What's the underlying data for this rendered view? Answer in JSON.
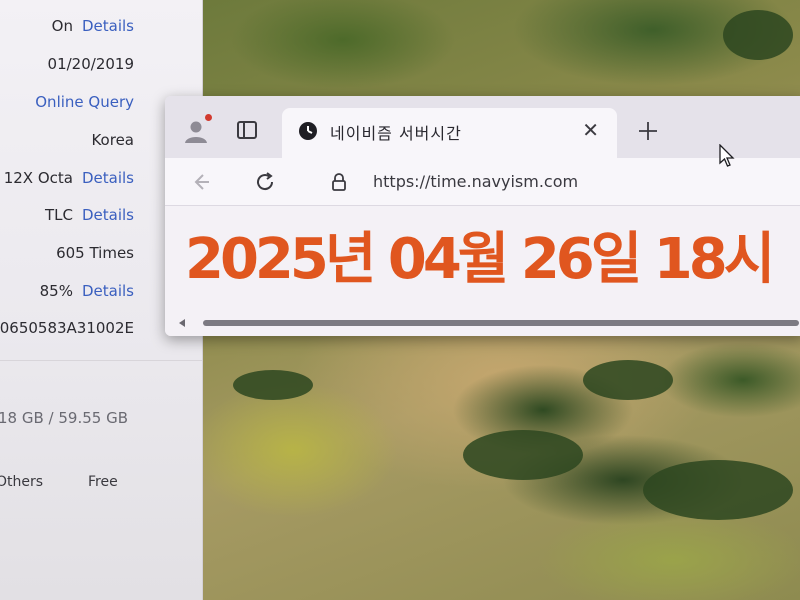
{
  "info_panel": {
    "rows": [
      {
        "value": "On",
        "link": "Details"
      },
      {
        "value": "01/20/2019",
        "link": ""
      },
      {
        "value": "",
        "link": "Online Query"
      },
      {
        "value": "Korea",
        "link": ""
      },
      {
        "value": "12X Octa",
        "link": "Details"
      },
      {
        "value": "TLC",
        "link": "Details"
      },
      {
        "value": "605 Times",
        "link": ""
      },
      {
        "value": "85%",
        "link": "Details"
      },
      {
        "value": "0650583A31002E",
        "link": ""
      }
    ],
    "storage": "18 GB / 59.55 GB",
    "legend": {
      "others": "Others",
      "free": "Free"
    }
  },
  "browser": {
    "tab": {
      "title": "네이비즘 서버시간",
      "favicon": "clock-icon",
      "close_icon": "close-icon"
    },
    "new_tab_icon": "plus-icon",
    "profile_icon": "profile-icon",
    "workspaces_icon": "tab-actions-icon",
    "back_icon": "back-arrow-icon",
    "reload_icon": "reload-icon",
    "lock_icon": "lock-icon",
    "url": "https://time.navyism.com",
    "content": {
      "server_time": "2025년 04월 26일 18시"
    },
    "accent_color": "#e0561f"
  }
}
